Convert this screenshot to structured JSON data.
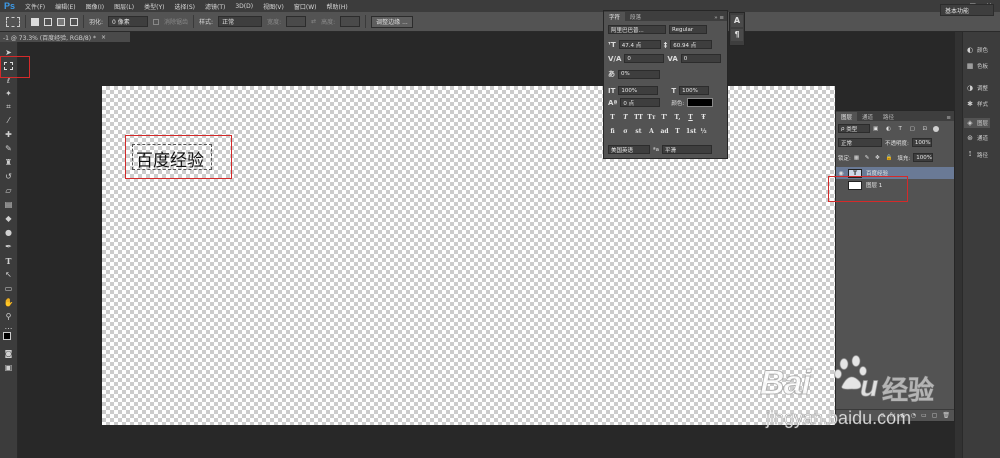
{
  "app": {
    "logo": "Ps"
  },
  "menu": [
    "文件(F)",
    "编辑(E)",
    "图像(I)",
    "图层(L)",
    "类型(Y)",
    "选择(S)",
    "滤镜(T)",
    "3D(D)",
    "视图(V)",
    "窗口(W)",
    "帮助(H)"
  ],
  "window_controls": [
    "–",
    "□",
    "✕"
  ],
  "options_bar": {
    "feather_label": "羽化:",
    "feather_value": "0 像素",
    "antialias_label": "消除锯齿",
    "style_label": "样式:",
    "style_value": "正常",
    "width_label": "宽度:",
    "height_label": "高度:",
    "refine_edge_button": "调整边缘 ...",
    "workspace": "基本功能"
  },
  "document_tab": {
    "title": "-1 @ 73.3% (百度经验, RGB/8) *",
    "close": "×"
  },
  "canvas": {
    "text": "百度经验"
  },
  "character_panel": {
    "tabs": [
      "字符",
      "段落"
    ],
    "font_family": "阿里巴巴普...",
    "font_style": "Regular",
    "font_size": "47.4 点",
    "leading": "60.94 点",
    "kerning": "0",
    "tracking": "0",
    "scale_percent": "0%",
    "vertical_scale": "100%",
    "horizontal_scale": "100%",
    "baseline_shift": "0 点",
    "color_label": "颜色:",
    "style_buttons": [
      "T",
      "T",
      "TT",
      "Tт",
      "T'",
      "T,",
      "T",
      "Ŧ"
    ],
    "opentype_buttons": [
      "fi",
      "σ",
      "st",
      "A",
      "ad",
      "T",
      "1st",
      "½"
    ],
    "language": "美国英语",
    "antialias_prefix": "ªa",
    "antialias": "平滑"
  },
  "mini_strip": {
    "buttons": [
      "A",
      "¶"
    ]
  },
  "layers_panel": {
    "tabs": [
      "图层",
      "通道",
      "路径"
    ],
    "filter_kind": "类型",
    "blend_mode": "正常",
    "opacity_label": "不透明度:",
    "opacity": "100%",
    "lock_label": "锁定:",
    "fill_label": "填充:",
    "fill": "100%",
    "layers": [
      {
        "name": "百度经验",
        "type": "text",
        "thumb": "T",
        "selected": true
      },
      {
        "name": "图层 1",
        "type": "pixel",
        "selected": false
      }
    ],
    "bottom_icons": [
      "⊖",
      "fx",
      "◐",
      "◔",
      "▭",
      "▢",
      "🗑"
    ]
  },
  "right_dock": {
    "items": [
      {
        "label": "颜色",
        "icon": "◐"
      },
      {
        "label": "色板",
        "icon": "▦"
      },
      {
        "label": "调整",
        "icon": "◑"
      },
      {
        "label": "样式",
        "icon": "✱"
      },
      {
        "label": "图层",
        "icon": "◈"
      },
      {
        "label": "通道",
        "icon": "⊛"
      },
      {
        "label": "路径",
        "icon": "⟟"
      }
    ]
  },
  "watermark": {
    "logo": "Bai",
    "logo_tail": "u",
    "brand": "经验",
    "url": "jingyan.baidu.com"
  },
  "colors": {
    "accent_highlight": "#d42a2a",
    "selected_layer": "#6a7a96",
    "ps_blue": "#3d9be9"
  }
}
